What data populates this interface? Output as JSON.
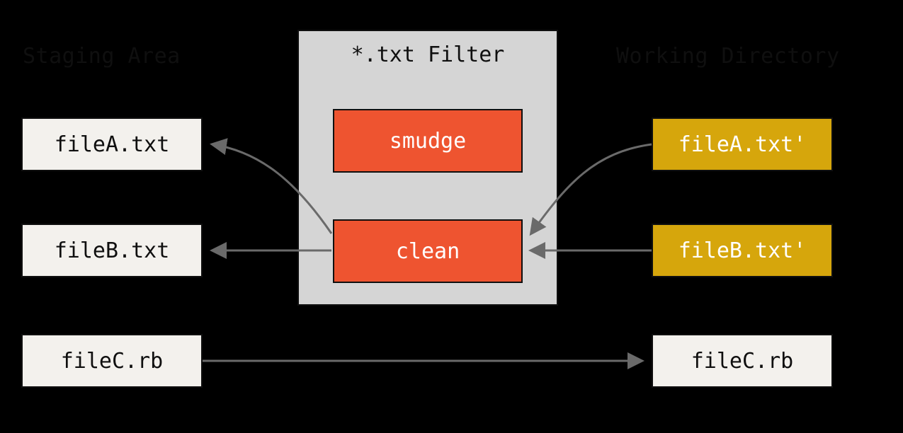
{
  "headings": {
    "staging": "Staging Area",
    "filter": "*.txt Filter",
    "working": "Working Directory"
  },
  "staging_files": {
    "a": "fileA.txt",
    "b": "fileB.txt",
    "c": "fileC.rb"
  },
  "working_files": {
    "a": "fileA.txt'",
    "b": "fileB.txt'",
    "c": "fileC.rb"
  },
  "filter_ops": {
    "smudge": "smudge",
    "clean": "clean"
  },
  "colors": {
    "background": "#000000",
    "box_bg": "#f3f1ed",
    "filter_bg": "#d5d5d5",
    "filter_op_bg": "#ee5430",
    "modified_bg": "#d6a60c",
    "arrow": "#6a6a6a",
    "border": "#0f0f0f"
  }
}
